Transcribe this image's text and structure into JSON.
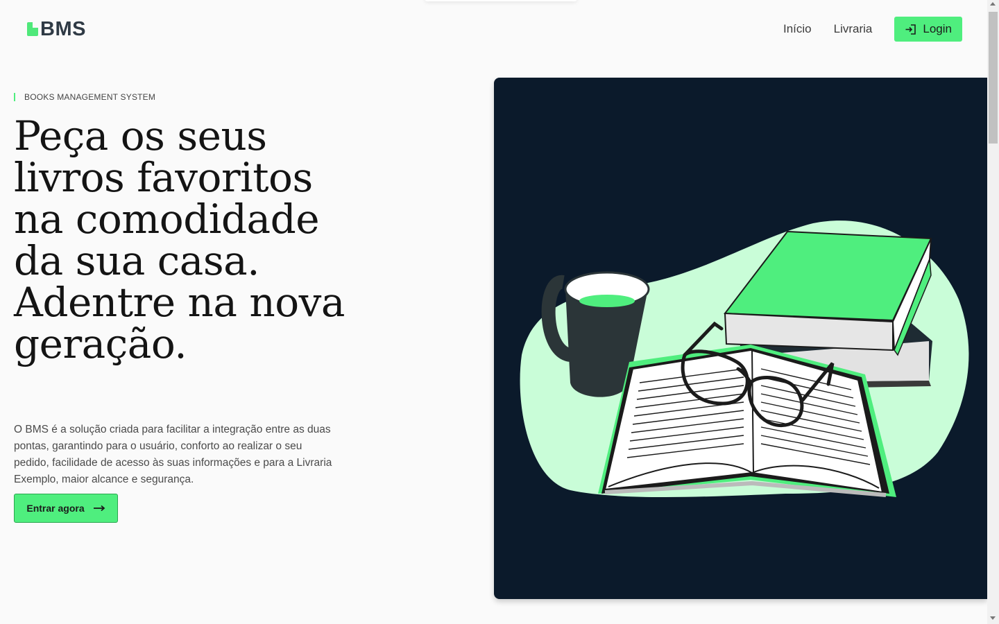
{
  "brand": {
    "name": "BMS",
    "accent": "#4fee7e",
    "dark": "#0b1a2b"
  },
  "nav": {
    "links": [
      {
        "label": "Início"
      },
      {
        "label": "Livraria"
      }
    ],
    "login_label": "Login",
    "login_icon": "login-arrow-icon"
  },
  "hero": {
    "eyebrow": "BOOKS MANAGEMENT SYSTEM",
    "headline": "Peça os seus livros favoritos na comodidade da sua casa. Adentre na nova geração.",
    "description": "O BMS é a solução criada para facilitar a integração entre as duas pontas, garantindo para o usuário, conforto ao realizar o seu pedido, facilidade de acesso às suas informações e para a Livraria Exemplo, maior alcance e segurança.",
    "cta_label": "Entrar agora",
    "cta_icon": "arrow-right-icon",
    "illustration": "books-coffee-glasses-illustration"
  }
}
